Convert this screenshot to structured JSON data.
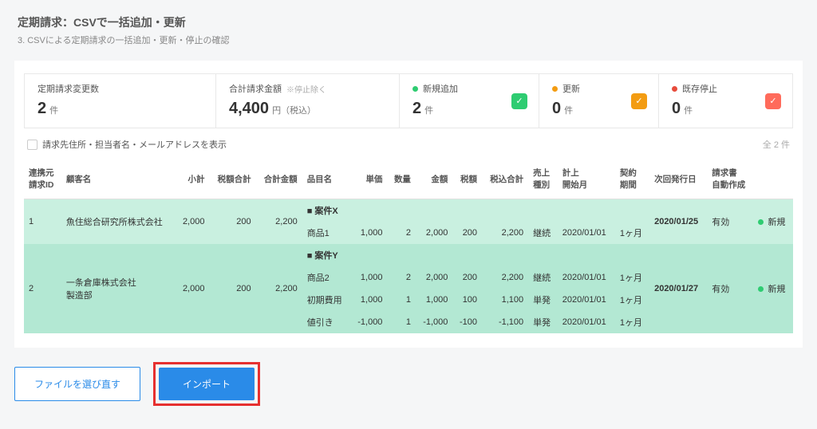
{
  "header": {
    "title": "定期請求：CSVで一括追加・更新",
    "subtitle": "3. CSVによる定期請求の一括追加・更新・停止の確認"
  },
  "stats": {
    "changeCount": {
      "label": "定期請求変更数",
      "value": "2",
      "unit": "件"
    },
    "totalAmount": {
      "label": "合計請求金額",
      "note": "※停止除く",
      "value": "4,400",
      "unit": "円（税込）"
    },
    "newAdd": {
      "label": "新規追加",
      "value": "2",
      "unit": "件"
    },
    "update": {
      "label": "更新",
      "value": "0",
      "unit": "件"
    },
    "stopped": {
      "label": "既存停止",
      "value": "0",
      "unit": "件"
    }
  },
  "options": {
    "showAddressLabel": "請求先住所・担当者名・メールアドレスを表示",
    "totalCount": "全 2 件"
  },
  "tableHeaders": {
    "sourceId": "連携元\n請求ID",
    "customer": "顧客名",
    "subtotal": "小計",
    "taxTotal": "税額合計",
    "grandTotal": "合計金額",
    "itemName": "品目名",
    "unitPrice": "単価",
    "qty": "数量",
    "amount": "金額",
    "tax": "税額",
    "taxInclTotal": "税込合計",
    "salesType": "売上\n種別",
    "startMonth": "計上\n開始月",
    "contractPeriod": "契約\n期間",
    "nextIssue": "次回発行日",
    "autoCreate": "請求書\n自動作成",
    "status": ""
  },
  "rows": [
    {
      "id": "1",
      "customer": "魚住総合研究所株式会社",
      "subtotal": "2,000",
      "taxTotal": "200",
      "grandTotal": "2,200",
      "projectTitle": "■ 案件X",
      "nextIssue": "2020/01/25",
      "autoCreate": "有効",
      "statusLabel": "新規",
      "items": [
        {
          "name": "商品1",
          "unitPrice": "1,000",
          "qty": "2",
          "amount": "2,000",
          "tax": "200",
          "taxIncl": "2,200",
          "salesType": "継続",
          "startMonth": "2020/01/01",
          "period": "1ヶ月"
        }
      ]
    },
    {
      "id": "2",
      "customer": "一条倉庫株式会社\n製造部",
      "subtotal": "2,000",
      "taxTotal": "200",
      "grandTotal": "2,200",
      "projectTitle": "■ 案件Y",
      "nextIssue": "2020/01/27",
      "autoCreate": "有効",
      "statusLabel": "新規",
      "items": [
        {
          "name": "商品2",
          "unitPrice": "1,000",
          "qty": "2",
          "amount": "2,000",
          "tax": "200",
          "taxIncl": "2,200",
          "salesType": "継続",
          "startMonth": "2020/01/01",
          "period": "1ヶ月"
        },
        {
          "name": "初期費用",
          "unitPrice": "1,000",
          "qty": "1",
          "amount": "1,000",
          "tax": "100",
          "taxIncl": "1,100",
          "salesType": "単発",
          "startMonth": "2020/01/01",
          "period": "1ヶ月"
        },
        {
          "name": "値引き",
          "unitPrice": "-1,000",
          "qty": "1",
          "amount": "-1,000",
          "tax": "-100",
          "taxIncl": "-1,100",
          "salesType": "単発",
          "startMonth": "2020/01/01",
          "period": "1ヶ月"
        }
      ]
    }
  ],
  "footer": {
    "reselectFile": "ファイルを選び直す",
    "import": "インポート"
  }
}
